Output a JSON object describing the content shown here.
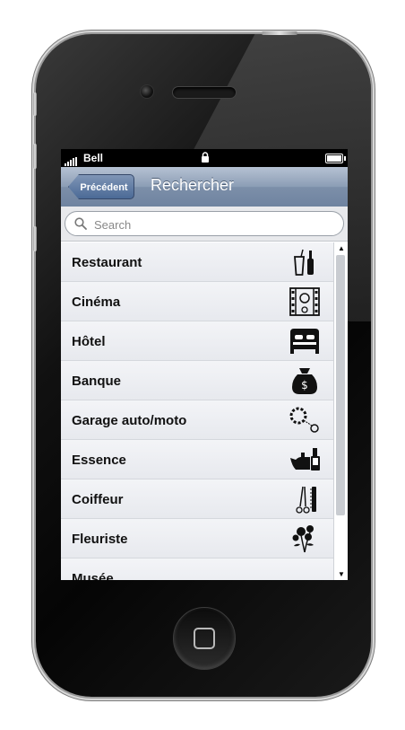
{
  "status": {
    "carrier": "Bell"
  },
  "nav": {
    "back_label": "Précédent",
    "title": "Rechercher"
  },
  "search": {
    "placeholder": "Search",
    "value": ""
  },
  "items": [
    {
      "label": "Restaurant",
      "icon": "restaurant-icon"
    },
    {
      "label": "Cinéma",
      "icon": "cinema-icon"
    },
    {
      "label": "Hôtel",
      "icon": "hotel-bed-icon"
    },
    {
      "label": "Banque",
      "icon": "money-bag-icon"
    },
    {
      "label": "Garage auto/moto",
      "icon": "garage-chain-icon"
    },
    {
      "label": "Essence",
      "icon": "fuel-can-icon"
    },
    {
      "label": "Coiffeur",
      "icon": "scissors-comb-icon"
    },
    {
      "label": "Fleuriste",
      "icon": "flowers-icon"
    },
    {
      "label": "Musée",
      "icon": "museum-icon"
    }
  ],
  "colors": {
    "navbar": "#7c8fa9",
    "back_button": "#4b6a96"
  }
}
